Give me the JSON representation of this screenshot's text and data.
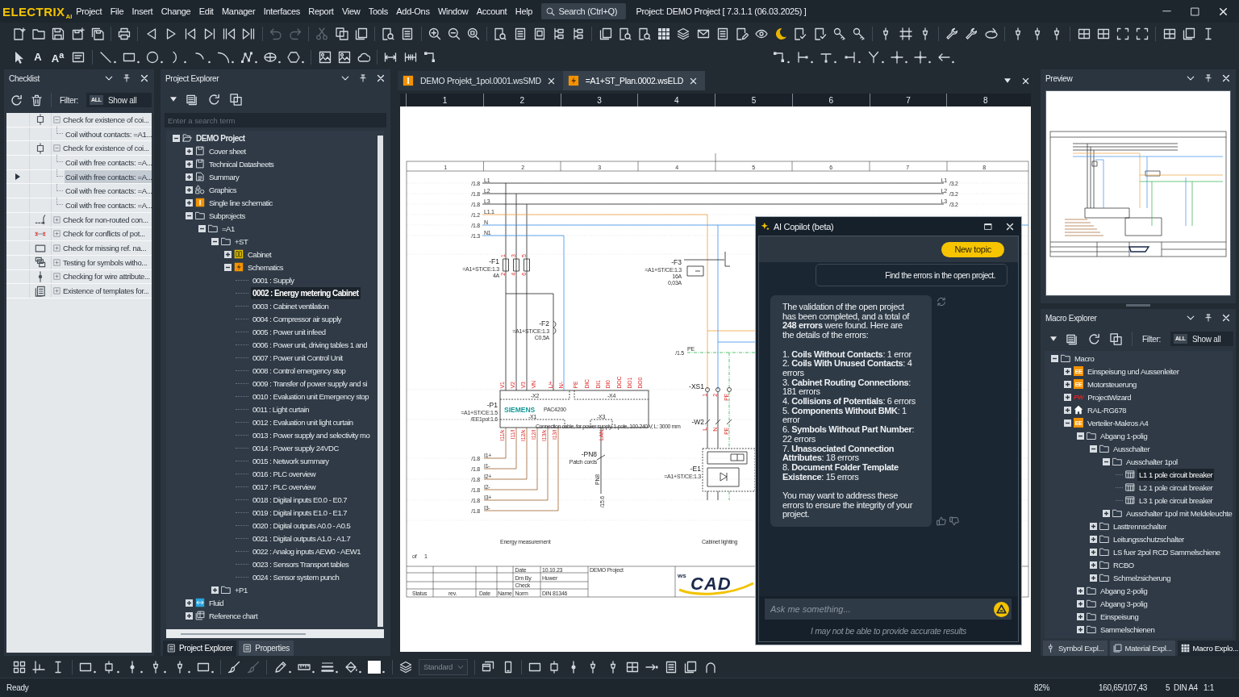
{
  "app": {
    "logo": "ELECTRIX",
    "logo_suffix": "AI",
    "menu": [
      "Project",
      "File",
      "Insert",
      "Change",
      "Edit",
      "Manager",
      "Interfaces",
      "Report",
      "View",
      "Tools",
      "Add-Ons",
      "Window",
      "Account",
      "Help"
    ],
    "search": {
      "placeholder": "Search (Ctrl+Q)"
    },
    "title": "Project: DEMO Project [ 7.3.1.1 (06.03.2025) ]"
  },
  "toolbar": {
    "text_tools": [
      {
        "label": "A"
      },
      {
        "label": "A$^{a}$"
      }
    ]
  },
  "checklist": {
    "title": "Checklist",
    "filter": {
      "label": "Filter:",
      "badge": "ALL",
      "value": "Show all"
    },
    "checks": [
      {
        "kind": "coil",
        "text": "Check for existence of coi...",
        "expanded": true,
        "selected": false,
        "children": [
          {
            "text": "Coil without contacts: =A1...",
            "selected": false
          }
        ]
      },
      {
        "kind": "coil",
        "text": "Check for existence of coi...",
        "expanded": true,
        "selected": false,
        "children": [
          {
            "text": "Coil with free contacts: =A...",
            "selected": false
          },
          {
            "text": "Coil with free contacts: =A...",
            "selected": true
          },
          {
            "text": "Coil with free contacts: =A...",
            "selected": false
          },
          {
            "text": "Coil with free contacts: =A...",
            "selected": false
          }
        ]
      },
      {
        "kind": "route",
        "text": "Check for non-routed con...",
        "expanded": false,
        "selected": false
      },
      {
        "kind": "conflict",
        "text": "Check for conflicts of pot...",
        "expanded": false,
        "selected": false
      },
      {
        "kind": "frame",
        "text": "Check for missing ref. na...",
        "expanded": false,
        "selected": false
      },
      {
        "kind": "symbols",
        "text": "Testing for symbols witho...",
        "expanded": false,
        "selected": false
      },
      {
        "kind": "wire",
        "text": "Checking for wire attribute...",
        "expanded": false,
        "selected": false
      },
      {
        "kind": "templates",
        "text": "Existence of templates for...",
        "expanded": false,
        "selected": false
      }
    ]
  },
  "project_explorer": {
    "title": "Project Explorer",
    "search": {
      "placeholder": "Enter a search term"
    },
    "tree": [
      {
        "kind": "project",
        "text": "DEMO Project",
        "expanded": true,
        "selected": false,
        "children": [
          {
            "kind": "sheet",
            "text": "Cover sheet",
            "expanded": false,
            "selected": false
          },
          {
            "kind": "sheet",
            "text": "Technical Datasheets",
            "expanded": false,
            "selected": false
          },
          {
            "kind": "document",
            "text": "Summary",
            "expanded": false,
            "selected": false
          },
          {
            "kind": "graphics",
            "text": "Graphics",
            "expanded": false,
            "selected": false
          },
          {
            "kind": "single-line",
            "text": "Single line schematic",
            "expanded": false,
            "selected": false
          },
          {
            "kind": "folder",
            "text": "Subprojects",
            "expanded": true,
            "selected": false,
            "children": [
              {
                "kind": "folder",
                "text": "=A1",
                "expanded": true,
                "selected": false,
                "children": [
                  {
                    "kind": "folder",
                    "text": "+ST",
                    "expanded": true,
                    "selected": false,
                    "children": [
                      {
                        "kind": "cabinet",
                        "text": "Cabinet",
                        "expanded": false,
                        "selected": false
                      },
                      {
                        "kind": "schematics",
                        "text": "Schematics",
                        "expanded": true,
                        "selected": false,
                        "children": [
                          {
                            "text": "0001 : Supply",
                            "selected": false
                          },
                          {
                            "text": "0002 : Energy metering Cabinet",
                            "selected": true
                          },
                          {
                            "text": "0003 : Cabinet ventilation",
                            "selected": false
                          },
                          {
                            "text": "0004 : Compressor air supply",
                            "selected": false
                          },
                          {
                            "text": "0005 : Power unit infeed",
                            "selected": false
                          },
                          {
                            "text": "0006 : Power unit, driving tables 1 and",
                            "selected": false
                          },
                          {
                            "text": "0007 : Power unit Control Unit",
                            "selected": false
                          },
                          {
                            "text": "0008 : Control emergency stop",
                            "selected": false
                          },
                          {
                            "text": "0009 : Transfer of power supply and si",
                            "selected": false
                          },
                          {
                            "text": "0010 : Evaluation unit Emergency stop",
                            "selected": false
                          },
                          {
                            "text": "0011 : Light curtain",
                            "selected": false
                          },
                          {
                            "text": "0012 : Evaluation unit light curtain",
                            "selected": false
                          },
                          {
                            "text": "0013 : Power supply and selectivity mo",
                            "selected": false
                          },
                          {
                            "text": "0014 : Power supply 24VDC",
                            "selected": false
                          },
                          {
                            "text": "0015 : Network summary",
                            "selected": false
                          },
                          {
                            "text": "0016 : PLC overview",
                            "selected": false
                          },
                          {
                            "text": "0017 : PLC overview",
                            "selected": false
                          },
                          {
                            "text": "0018 : Digital inputs E0.0 - E0.7",
                            "selected": false
                          },
                          {
                            "text": "0019 : Digital inputs E1.0 - E1.7",
                            "selected": false
                          },
                          {
                            "text": "0020 : Digital outputs A0.0 - A0.5",
                            "selected": false
                          },
                          {
                            "text": "0021 : Digital outputs A1.0 - A1.7",
                            "selected": false
                          },
                          {
                            "text": "0022 : Analog inputs AEW0 - AEW1",
                            "selected": false
                          },
                          {
                            "text": "0023 : Sensors Transport tables",
                            "selected": false
                          },
                          {
                            "text": "0024 : Sensor system punch",
                            "selected": false
                          }
                        ]
                      }
                    ]
                  },
                  {
                    "kind": "folder",
                    "text": "+P1",
                    "expanded": false,
                    "selected": false
                  }
                ]
              }
            ]
          },
          {
            "kind": "fluid",
            "text": "Fluid",
            "expanded": false,
            "selected": false
          },
          {
            "kind": "chart",
            "text": "Reference chart",
            "expanded": false,
            "selected": false
          }
        ]
      }
    ],
    "tabs": [
      {
        "label": "Project Explorer",
        "selected": true
      },
      {
        "label": "Properties",
        "selected": false
      }
    ]
  },
  "documents": {
    "tabs": [
      {
        "kind": "single-line",
        "label": "DEMO Projekt_1pol.0001.wsSMD",
        "selected": false
      },
      {
        "kind": "schematic",
        "label": "=A1+ST_Plan.0002.wsELD",
        "selected": true
      }
    ],
    "ruler": [
      "1",
      "2",
      "3",
      "4",
      "5",
      "6",
      "7",
      "8"
    ],
    "sheet": {
      "columns": [
        "1",
        "2",
        "3",
        "4",
        "5",
        "6",
        "7",
        "8"
      ],
      "feeds": [
        {
          "ref": "/1.8",
          "name": "L1"
        },
        {
          "ref": "/1.8",
          "name": "L2"
        },
        {
          "ref": "/1.8",
          "name": "L3"
        },
        {
          "ref": "/1.2",
          "name": "L1.1"
        },
        {
          "ref": "/1.8",
          "name": "N"
        },
        {
          "ref": "/1.3",
          "name": "N1"
        }
      ],
      "outgoing": [
        {
          "name": "L1",
          "ref": "/3.2"
        },
        {
          "name": "L2",
          "ref": "/3.2"
        },
        {
          "name": "L3",
          "ref": "/3.2"
        }
      ],
      "earth": {
        "ref": "/1.5",
        "name": "PE"
      },
      "devices": [
        {
          "tag": "-F1",
          "notes": [
            "=A1+ST/CE:1.3",
            "4A"
          ]
        },
        {
          "tag": "-F2",
          "notes": [
            "=A1+ST/CE:1.3",
            "C0,5A"
          ]
        },
        {
          "tag": "-F3",
          "notes": [
            "=A1+ST/CE:1.3",
            "16A",
            "0,03A"
          ]
        },
        {
          "tag": "-P1",
          "notes": [
            "=A1+ST/CE:1.5",
            "/EE1pol:1.6"
          ]
        },
        {
          "tag": "-XS1"
        },
        {
          "tag": "-W2"
        },
        {
          "tag": "-E1",
          "notes": [
            "=A1+ST/CE:1.3"
          ]
        },
        {
          "tag": "-PN8",
          "notes": [
            "Patch cords"
          ]
        }
      ],
      "fuse_terminals": {
        "inputs": [
          "1",
          "3",
          "5"
        ],
        "outputs": [
          "2",
          "4",
          "6"
        ]
      },
      "socket_terminals": [
        "1",
        "2",
        "PE"
      ],
      "cable_cores": [
        "L",
        "N",
        "PE"
      ],
      "meter": {
        "brand": "SIEMENS",
        "model": "PAC4200",
        "connectors": [
          "-X2",
          "-X4",
          "-X1",
          "-X3"
        ],
        "supply_terminals": [
          "V1",
          "V2",
          "V3",
          "VN",
          "L/+",
          "N/-",
          "PE",
          "DIC",
          "DI1",
          "DI0",
          "DOC",
          "DO1",
          "DO0"
        ],
        "input_terminals": [
          "I11/k",
          "I11/l",
          "I12/k",
          "I12/l",
          "I13/k",
          "I13/l"
        ],
        "network_terminal": "LAN"
      },
      "cable_note": "Connection cable, for power supply, 1-pole, 100-240 V, L: 3000 mm",
      "cable_tag": "PN8",
      "current_inputs": [
        {
          "ref": "/1.8",
          "name": "I1+"
        },
        {
          "ref": "/1.8",
          "name": "I1-"
        },
        {
          "ref": "/1.8",
          "name": "I2+"
        },
        {
          "ref": "/1.8",
          "name": "I2-"
        },
        {
          "ref": "/1.8",
          "name": "I3+"
        },
        {
          "ref": "/1.8",
          "name": "I3-"
        }
      ],
      "network_ref": "/15.6",
      "sections": [
        "Energy measurement",
        "Cabinet lighting"
      ],
      "sheet_of": "of",
      "sheet_total": "1",
      "title_block": {
        "fields": [
          {
            "label": "Date",
            "value": "10.10.23"
          },
          {
            "label": "Drn By",
            "value": "Huwer"
          },
          {
            "label": "Check"
          },
          {
            "label": "Norm",
            "value": "DIN 81346"
          }
        ],
        "project": "DEMO Project",
        "revision_columns": [
          "Status",
          "rev.",
          "Date",
          "Name"
        ],
        "logo": {
          "prefix": "ws",
          "name": "CAD"
        }
      }
    }
  },
  "copilot": {
    "title": "AI Copilot (beta)",
    "new_topic": "New topic",
    "messages": [
      {
        "kind": "user",
        "text": "Find the errors in the open project."
      },
      {
        "kind": "assistant",
        "intro": "The validation of the open project has been completed, and a total of **248 errors** were found. Here are the details of the errors:",
        "items": [
          "1. **Coils Without Contacts**: 1 error",
          "2. **Coils With Unused Contacts**: 4 errors",
          "3. **Cabinet Routing Connections**: 181 errors",
          "4. **Collisions of Potentials**: 6 errors",
          "5. **Components Without BMK**: 1 error",
          "6. **Symbols Without Part Number**: 22 errors",
          "7. **Unassociated Connection Attributes**: 18 errors",
          "8. **Document Folder Template Existence**: 15 errors"
        ],
        "outro": "You may want to address these errors to ensure the integrity of your project."
      }
    ],
    "input": {
      "placeholder": "Ask me something..."
    },
    "disclaimer": "I may not be able to provide accurate results"
  },
  "preview": {
    "title": "Preview"
  },
  "macro_explorer": {
    "title": "Macro Explorer",
    "filter": {
      "label": "Filter:",
      "badge": "ALL",
      "value": "Show all"
    },
    "tree": [
      {
        "kind": "folder",
        "text": "Macro",
        "expanded": true,
        "selected": false,
        "children": [
          {
            "kind": "badge",
            "badge": "EE",
            "text": "Einspeisung und Aussenleiter",
            "expanded": false,
            "selected": false
          },
          {
            "kind": "badge",
            "badge": "EE",
            "text": "Motorsteuerung",
            "expanded": false,
            "selected": false
          },
          {
            "kind": "wizard",
            "badge": "PW",
            "text": "ProjectWizard",
            "expanded": false,
            "selected": false
          },
          {
            "kind": "house",
            "text": "RAL-RG678",
            "expanded": false,
            "selected": false
          },
          {
            "kind": "badge",
            "badge": "EE",
            "text": "Verteiler-Makros A4",
            "expanded": true,
            "selected": false,
            "children": [
              {
                "kind": "folder",
                "text": "Abgang 1-polig",
                "expanded": true,
                "selected": false,
                "children": [
                  {
                    "kind": "folder",
                    "text": "Ausschalter",
                    "expanded": true,
                    "selected": false,
                    "children": [
                      {
                        "kind": "folder",
                        "text": "Ausschalter 1pol",
                        "expanded": true,
                        "selected": false,
                        "children": [
                          {
                            "kind": "macro",
                            "text": "L1 1 pole circuit breaker",
                            "selected": true
                          },
                          {
                            "kind": "macro",
                            "text": "L2 1 pole circuit breaker",
                            "selected": false
                          },
                          {
                            "kind": "macro",
                            "text": "L3 1 pole circuit breaker",
                            "selected": false
                          }
                        ]
                      },
                      {
                        "kind": "folder",
                        "text": "Ausschalter 1pol mit Meldeleuchte",
                        "expanded": false,
                        "selected": false
                      }
                    ]
                  },
                  {
                    "kind": "folder",
                    "text": "Lasttrennschalter",
                    "expanded": false,
                    "selected": false
                  },
                  {
                    "kind": "folder",
                    "text": "Leitungsschutzschalter",
                    "expanded": false,
                    "selected": false
                  },
                  {
                    "kind": "folder",
                    "text": "LS fuer 2pol RCD Sammelschiene",
                    "expanded": false,
                    "selected": false
                  },
                  {
                    "kind": "folder",
                    "text": "RCBO",
                    "expanded": false,
                    "selected": false
                  },
                  {
                    "kind": "folder",
                    "text": "Schmelzsicherung",
                    "expanded": false,
                    "selected": false
                  }
                ]
              },
              {
                "kind": "folder",
                "text": "Abgang 2-polig",
                "expanded": false,
                "selected": false
              },
              {
                "kind": "folder",
                "text": "Abgang 3-polig",
                "expanded": false,
                "selected": false
              },
              {
                "kind": "folder",
                "text": "Einspeisung",
                "expanded": false,
                "selected": false
              },
              {
                "kind": "folder",
                "text": "Sammelschienen",
                "expanded": false,
                "selected": false
              }
            ]
          }
        ]
      }
    ],
    "tabs": [
      {
        "label": "Symbol Expl...",
        "selected": false
      },
      {
        "label": "Material Expl...",
        "selected": false
      },
      {
        "label": "Macro Explo...",
        "selected": true
      }
    ]
  },
  "bottom_toolbar": {
    "style_selector": {
      "value": "Standard",
      "disabled": true
    }
  },
  "status_bar": {
    "text": "Ready",
    "zoom": "82%",
    "coordinates": "160,65/107,43",
    "page": "5",
    "format": "DIN A4",
    "scale": "1:1"
  }
}
